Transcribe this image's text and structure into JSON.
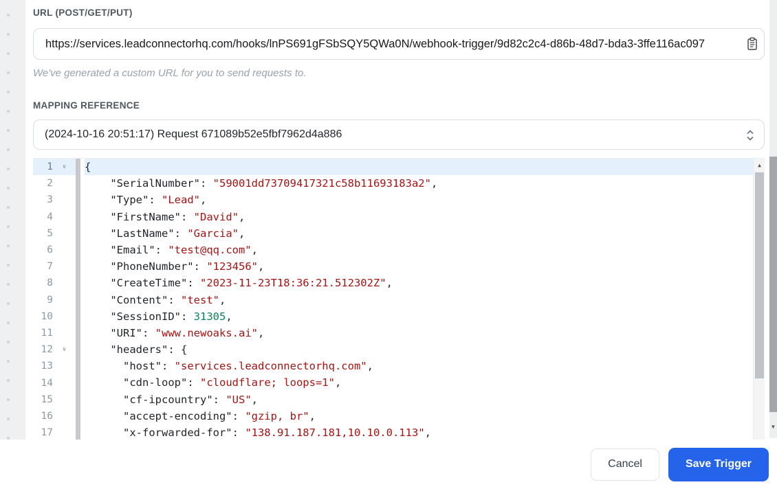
{
  "url_section": {
    "label": "URL (POST/GET/PUT)",
    "value": "https://services.leadconnectorhq.com/hooks/lnPS691gFSbSQY5QWa0N/webhook-trigger/9d82c2c4-d86b-48d7-bda3-3ffe116ac097",
    "helper_text": "We've generated a custom URL for you to send requests to.",
    "copy_icon": "clipboard-icon"
  },
  "mapping_section": {
    "label": "MAPPING REFERENCE",
    "selected_option": "(2024-10-16 20:51:17) Request 671089b52e5fbf7962d4a886",
    "dropdown_icon": "up-down-chevron-icon"
  },
  "editor": {
    "language": "json",
    "active_line": 1,
    "fold_icon": "chevron-down",
    "lines": [
      {
        "n": 1,
        "fold": true,
        "tokens": [
          {
            "c": "p",
            "v": "{"
          }
        ]
      },
      {
        "n": 2,
        "fold": false,
        "tokens": [
          {
            "c": "p",
            "v": "    "
          },
          {
            "c": "k",
            "v": "\"SerialNumber\""
          },
          {
            "c": "p",
            "v": ": "
          },
          {
            "c": "s",
            "v": "\"59001dd73709417321c58b11693183a2\""
          },
          {
            "c": "p",
            "v": ","
          }
        ]
      },
      {
        "n": 3,
        "fold": false,
        "tokens": [
          {
            "c": "p",
            "v": "    "
          },
          {
            "c": "k",
            "v": "\"Type\""
          },
          {
            "c": "p",
            "v": ": "
          },
          {
            "c": "s",
            "v": "\"Lead\""
          },
          {
            "c": "p",
            "v": ","
          }
        ]
      },
      {
        "n": 4,
        "fold": false,
        "tokens": [
          {
            "c": "p",
            "v": "    "
          },
          {
            "c": "k",
            "v": "\"FirstName\""
          },
          {
            "c": "p",
            "v": ": "
          },
          {
            "c": "s",
            "v": "\"David\""
          },
          {
            "c": "p",
            "v": ","
          }
        ]
      },
      {
        "n": 5,
        "fold": false,
        "tokens": [
          {
            "c": "p",
            "v": "    "
          },
          {
            "c": "k",
            "v": "\"LastName\""
          },
          {
            "c": "p",
            "v": ": "
          },
          {
            "c": "s",
            "v": "\"Garcia\""
          },
          {
            "c": "p",
            "v": ","
          }
        ]
      },
      {
        "n": 6,
        "fold": false,
        "tokens": [
          {
            "c": "p",
            "v": "    "
          },
          {
            "c": "k",
            "v": "\"Email\""
          },
          {
            "c": "p",
            "v": ": "
          },
          {
            "c": "s",
            "v": "\"test@qq.com\""
          },
          {
            "c": "p",
            "v": ","
          }
        ]
      },
      {
        "n": 7,
        "fold": false,
        "tokens": [
          {
            "c": "p",
            "v": "    "
          },
          {
            "c": "k",
            "v": "\"PhoneNumber\""
          },
          {
            "c": "p",
            "v": ": "
          },
          {
            "c": "s",
            "v": "\"123456\""
          },
          {
            "c": "p",
            "v": ","
          }
        ]
      },
      {
        "n": 8,
        "fold": false,
        "tokens": [
          {
            "c": "p",
            "v": "    "
          },
          {
            "c": "k",
            "v": "\"CreateTime\""
          },
          {
            "c": "p",
            "v": ": "
          },
          {
            "c": "s",
            "v": "\"2023-11-23T18:36:21.512302Z\""
          },
          {
            "c": "p",
            "v": ","
          }
        ]
      },
      {
        "n": 9,
        "fold": false,
        "tokens": [
          {
            "c": "p",
            "v": "    "
          },
          {
            "c": "k",
            "v": "\"Content\""
          },
          {
            "c": "p",
            "v": ": "
          },
          {
            "c": "s",
            "v": "\"test\""
          },
          {
            "c": "p",
            "v": ","
          }
        ]
      },
      {
        "n": 10,
        "fold": false,
        "tokens": [
          {
            "c": "p",
            "v": "    "
          },
          {
            "c": "k",
            "v": "\"SessionID\""
          },
          {
            "c": "p",
            "v": ": "
          },
          {
            "c": "n",
            "v": "31305"
          },
          {
            "c": "p",
            "v": ","
          }
        ]
      },
      {
        "n": 11,
        "fold": false,
        "tokens": [
          {
            "c": "p",
            "v": "    "
          },
          {
            "c": "k",
            "v": "\"URI\""
          },
          {
            "c": "p",
            "v": ": "
          },
          {
            "c": "s",
            "v": "\"www.newoaks.ai\""
          },
          {
            "c": "p",
            "v": ","
          }
        ]
      },
      {
        "n": 12,
        "fold": true,
        "tokens": [
          {
            "c": "p",
            "v": "    "
          },
          {
            "c": "k",
            "v": "\"headers\""
          },
          {
            "c": "p",
            "v": ": {"
          }
        ]
      },
      {
        "n": 13,
        "fold": false,
        "tokens": [
          {
            "c": "p",
            "v": "      "
          },
          {
            "c": "k",
            "v": "\"host\""
          },
          {
            "c": "p",
            "v": ": "
          },
          {
            "c": "s",
            "v": "\"services.leadconnectorhq.com\""
          },
          {
            "c": "p",
            "v": ","
          }
        ]
      },
      {
        "n": 14,
        "fold": false,
        "tokens": [
          {
            "c": "p",
            "v": "      "
          },
          {
            "c": "k",
            "v": "\"cdn-loop\""
          },
          {
            "c": "p",
            "v": ": "
          },
          {
            "c": "s",
            "v": "\"cloudflare; loops=1\""
          },
          {
            "c": "p",
            "v": ","
          }
        ]
      },
      {
        "n": 15,
        "fold": false,
        "tokens": [
          {
            "c": "p",
            "v": "      "
          },
          {
            "c": "k",
            "v": "\"cf-ipcountry\""
          },
          {
            "c": "p",
            "v": ": "
          },
          {
            "c": "s",
            "v": "\"US\""
          },
          {
            "c": "p",
            "v": ","
          }
        ]
      },
      {
        "n": 16,
        "fold": false,
        "tokens": [
          {
            "c": "p",
            "v": "      "
          },
          {
            "c": "k",
            "v": "\"accept-encoding\""
          },
          {
            "c": "p",
            "v": ": "
          },
          {
            "c": "s",
            "v": "\"gzip, br\""
          },
          {
            "c": "p",
            "v": ","
          }
        ]
      },
      {
        "n": 17,
        "fold": false,
        "tokens": [
          {
            "c": "p",
            "v": "      "
          },
          {
            "c": "k",
            "v": "\"x-forwarded-for\""
          },
          {
            "c": "p",
            "v": ": "
          },
          {
            "c": "s",
            "v": "\"138.91.187.181,10.10.0.113\""
          },
          {
            "c": "p",
            "v": ","
          }
        ]
      }
    ]
  },
  "footer": {
    "cancel_label": "Cancel",
    "save_label": "Save Trigger"
  },
  "colors": {
    "accent_blue": "#2563eb",
    "string_token": "#a31515",
    "number_token": "#098658",
    "key_token": "#1f2328",
    "active_line_bg": "#e4f0fb",
    "backdrop_dot": "#d3d7dc"
  }
}
